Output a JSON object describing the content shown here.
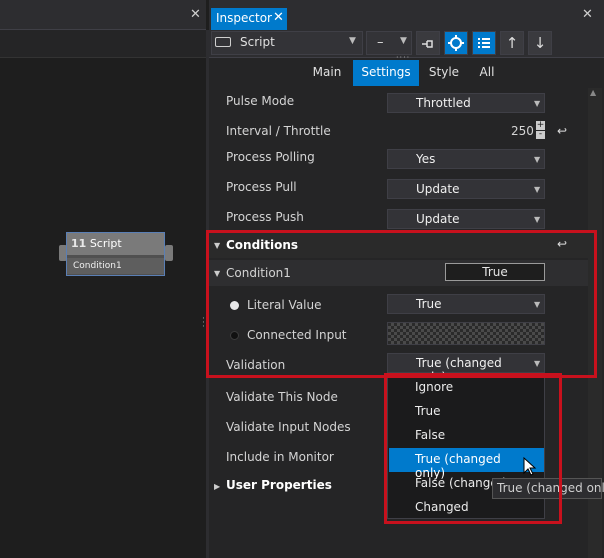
{
  "left_panel": {
    "close_glyph": "✕"
  },
  "node": {
    "number": "11",
    "title": "Script",
    "body": "Condition1"
  },
  "inspector": {
    "tab_title": "Inspector",
    "tab_close_glyph": "✕",
    "panel_close_glyph": "✕",
    "toolbar": {
      "object_dropdown": "Script",
      "minus_label": "–",
      "icons": [
        "pin-icon",
        "target-icon",
        "list-icon",
        "arrow-up-icon",
        "arrow-down-icon"
      ],
      "grip": "····"
    },
    "subtabs": {
      "items": [
        "Main",
        "Settings",
        "Style",
        "All"
      ],
      "active": "Settings"
    },
    "settings": {
      "pulse_mode": {
        "label": "Pulse Mode",
        "value": "Throttled"
      },
      "interval": {
        "label": "Interval / Throttle",
        "value": "250"
      },
      "process_polling": {
        "label": "Process Polling",
        "value": "Yes"
      },
      "process_pull": {
        "label": "Process Pull",
        "value": "Update"
      },
      "process_push": {
        "label": "Process Push",
        "value": "Update"
      }
    },
    "conditions": {
      "header": "Conditions",
      "condition1": {
        "label": "Condition1",
        "value": "True",
        "literal_value": {
          "label": "Literal Value",
          "value": "True"
        },
        "connected_input": {
          "label": "Connected Input"
        },
        "validation": {
          "label": "Validation",
          "value": "True (changed only)"
        }
      }
    },
    "more": {
      "validate_this_node": "Validate This Node",
      "validate_input_nodes": "Validate Input Nodes",
      "include_in_monitor": "Include in Monitor",
      "user_properties": "User Properties"
    },
    "validation_popup": {
      "options": [
        "Ignore",
        "True",
        "False",
        "True (changed only)",
        "False (changed",
        "Changed"
      ],
      "selected": "True (changed only)",
      "tooltip": "True (changed only)"
    }
  },
  "colors": {
    "accent": "#007acc",
    "highlight_box": "#c8111d",
    "background": "#252526"
  }
}
